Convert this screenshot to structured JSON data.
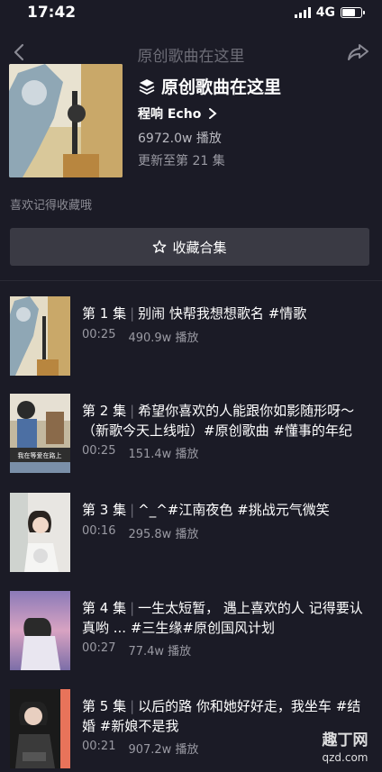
{
  "status_bar": {
    "time": "17:42",
    "network": "4G"
  },
  "nav": {
    "title": "原创歌曲在这里",
    "back_icon": "chevron-left-icon",
    "share_icon": "share-arrow-icon"
  },
  "collection": {
    "title": "原创歌曲在这里",
    "author": "程响 Echo",
    "plays": "6972.0w 播放",
    "update": "更新至第 21 集",
    "fav_hint": "喜欢记得收藏哦",
    "collect_label": "收藏合集"
  },
  "episodes": [
    {
      "num": "第 1 集",
      "title": "别闹 快帮我想想歌名 #情歌",
      "duration": "00:25",
      "plays": "490.9w 播放"
    },
    {
      "num": "第 2 集",
      "title": "希望你喜欢的人能跟你如影随形呀～（新歌今天上线啦）#原创歌曲 #懂事的年纪",
      "duration": "00:25",
      "plays": "151.4w 播放",
      "thumb_text": "我在等爱在路上"
    },
    {
      "num": "第 3 集",
      "title": "^_^#江南夜色 #挑战元气微笑",
      "duration": "00:16",
      "plays": "295.8w 播放"
    },
    {
      "num": "第 4 集",
      "title": "一生太短暂， 遇上喜欢的人 记得要认真哟 ... #三生缘#原创国风计划",
      "duration": "00:27",
      "plays": "77.4w 播放"
    },
    {
      "num": "第 5 集",
      "title": "以后的路 你和她好好走，我坐车 #结婚 #新娘不是我",
      "duration": "00:21",
      "plays": "907.2w 播放"
    }
  ],
  "watermark": {
    "line1": "趣丁网",
    "line2": "qzd.com"
  },
  "colors": {
    "background": "#1b1b26",
    "button": "#3a3a44",
    "muted": "#9a9aa3"
  }
}
